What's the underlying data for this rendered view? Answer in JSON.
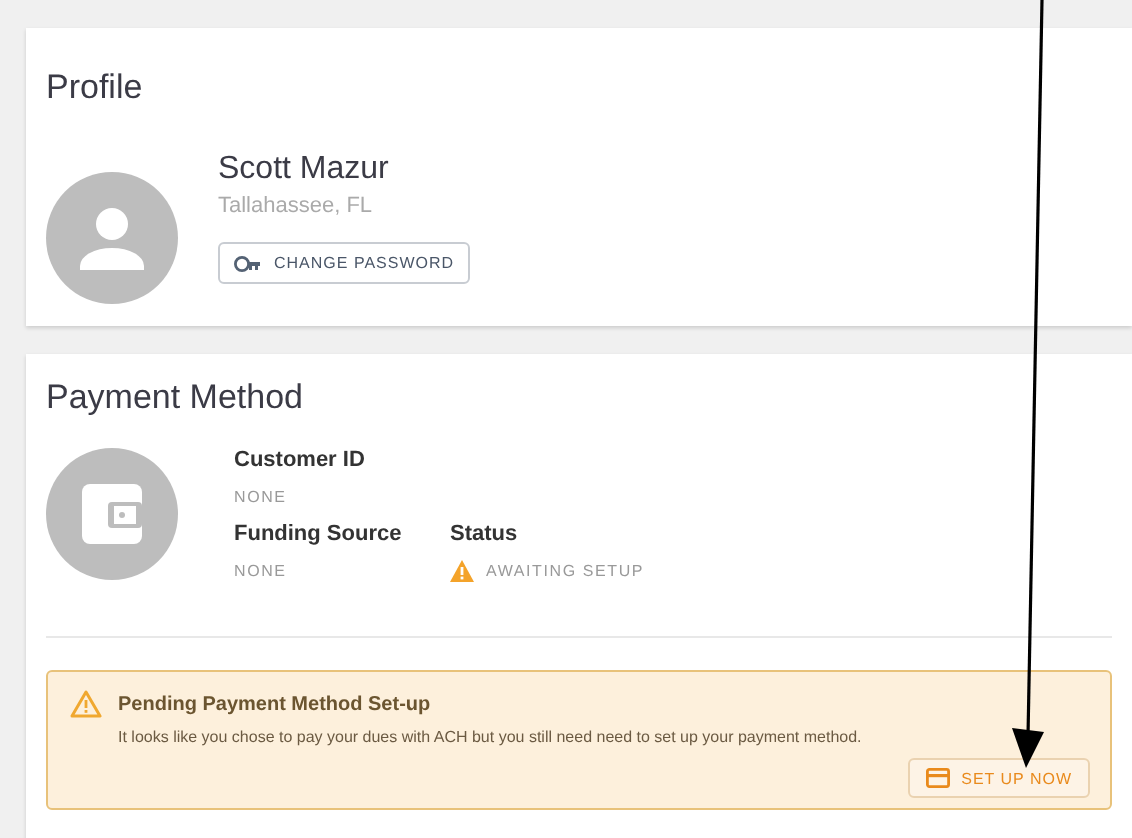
{
  "profile": {
    "title": "Profile",
    "name": "Scott Mazur",
    "location": "Tallahassee, FL",
    "button": "CHANGE PASSWORD"
  },
  "payment": {
    "title": "Payment Method",
    "fields": [
      {
        "label": "Customer ID",
        "value": "NONE",
        "kind": "plain"
      },
      {
        "label": "Funding Source",
        "value": "NONE",
        "kind": "plain"
      },
      {
        "label": "Status",
        "value": "AWAITING SETUP",
        "kind": "warning"
      }
    ],
    "alert": {
      "title": "Pending Payment Method Set-up",
      "message": "It looks like you chose to pay your dues with ACH but you still need need to set up your payment method.",
      "button": "SET UP NOW"
    }
  }
}
